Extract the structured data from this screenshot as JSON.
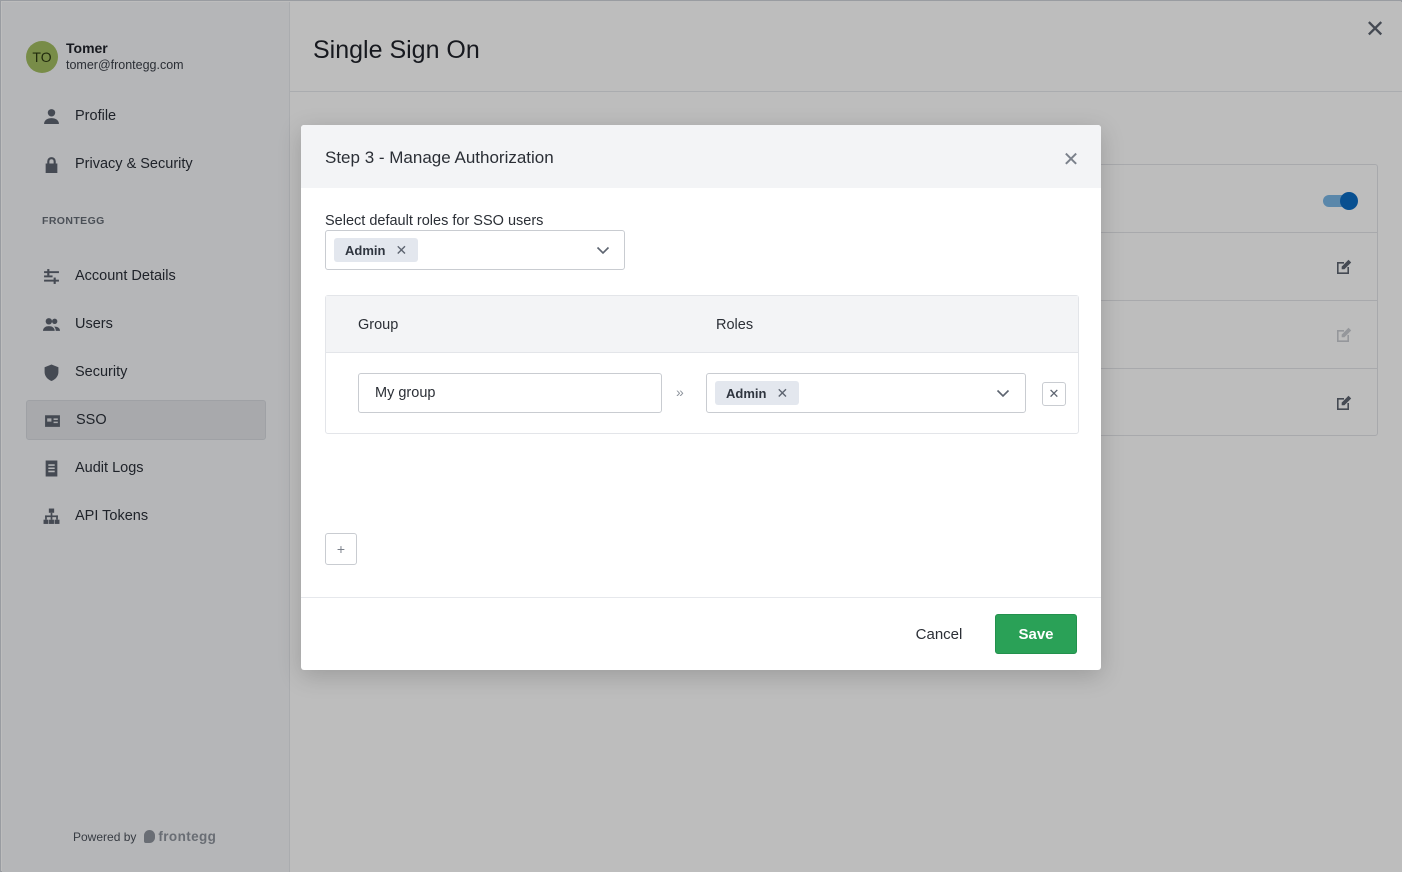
{
  "user": {
    "initials": "TO",
    "name": "Tomer",
    "email": "tomer@frontegg.com"
  },
  "sidebar": {
    "personal_items": [
      {
        "label": "Profile",
        "icon": "person-icon"
      },
      {
        "label": "Privacy & Security",
        "icon": "lock-icon"
      }
    ],
    "section_label": "FRONTEGG",
    "org_items": [
      {
        "label": "Account Details",
        "icon": "sliders-icon"
      },
      {
        "label": "Users",
        "icon": "users-icon"
      },
      {
        "label": "Security",
        "icon": "shield-icon"
      },
      {
        "label": "SSO",
        "icon": "sso-icon",
        "active": true
      },
      {
        "label": "Audit Logs",
        "icon": "document-icon"
      },
      {
        "label": "API Tokens",
        "icon": "hierarchy-icon"
      }
    ],
    "powered_by": "Powered by",
    "brand": "frontegg"
  },
  "main": {
    "title": "Single Sign On",
    "close_icon": "close-icon"
  },
  "card": {
    "toggle_on": true,
    "toggle_color": "#0c6cc4"
  },
  "modal": {
    "title": "Step 3 - Manage Authorization",
    "default_roles_label": "Select default roles for SSO users",
    "default_roles": [
      "Admin"
    ],
    "table": {
      "group_header": "Group",
      "roles_header": "Roles",
      "rows": [
        {
          "group": "My group",
          "separator": "»",
          "roles": [
            "Admin"
          ]
        }
      ]
    },
    "add_label": "+",
    "cancel_label": "Cancel",
    "save_label": "Save",
    "save_color": "#2aa157"
  }
}
